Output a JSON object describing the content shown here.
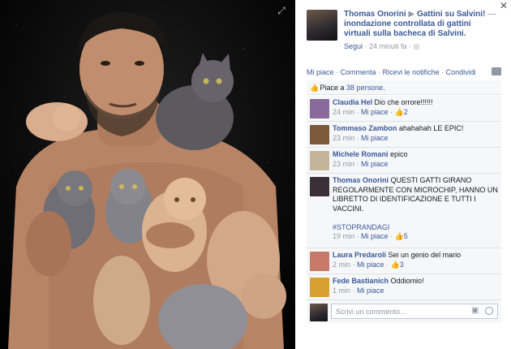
{
  "post": {
    "author": "Thomas Onorini",
    "arrow": "▶",
    "target": "Gattini su Salvini!",
    "separator": " — ",
    "description": "inondazione controllata di gattini virtuali sulla bacheca di Salvini.",
    "follow": "Segui",
    "time": "24 minuti fa",
    "audience": "◎"
  },
  "actions": [
    "Mi piace",
    "Commenta",
    "Ricevi le notifiche",
    "Condividi"
  ],
  "likes": {
    "prefix": "Piace a ",
    "count": "38 persone",
    "suffix": "."
  },
  "comments": [
    {
      "name": "Claudia Hel",
      "text": "Dio che orrore!!!!!!",
      "time": "24 min",
      "like": "Mi piace",
      "likes": "2",
      "avatar": "#8a6a9a"
    },
    {
      "name": "Tommaso Zambon",
      "text": "ahahahah LE EPIC!",
      "time": "23 min",
      "like": "Mi piace",
      "likes": "",
      "avatar": "#7a5a3a"
    },
    {
      "name": "Michele Romani",
      "text": "epico",
      "time": "23 min",
      "like": "Mi piace",
      "likes": "",
      "avatar": "#c4b59a"
    },
    {
      "name": "Thomas Onorini",
      "text": "QUESTI GATTI GIRANO REGOLARMENTE CON MICROCHIP, HANNO UN LIBRETTO DI IDENTIFICAZIONE E TUTTI I VACCINI.",
      "tag": "#STOPRANDAGI",
      "time": "19 min",
      "like": "Mi piace",
      "likes": "5",
      "avatar": "#3a3035"
    },
    {
      "name": "Laura Predaroli",
      "text": "Sei un genio del mario",
      "time": "2 min",
      "like": "Mi piace",
      "likes": "3",
      "avatar": "#c77a6a"
    },
    {
      "name": "Fede Bastianich",
      "text": "Oddiomio!",
      "time": "1 min",
      "like": "Mi piace",
      "likes": "",
      "avatar": "#d8a030"
    }
  ],
  "write": {
    "placeholder": "Scrivi un commento..."
  },
  "icons": {
    "thumb": "👍",
    "camera": "📷",
    "expand": "⤢",
    "close": "✕"
  },
  "colors": {
    "link": "#3b5998",
    "meta": "#9197a3",
    "panel": "#f6f7f9"
  }
}
